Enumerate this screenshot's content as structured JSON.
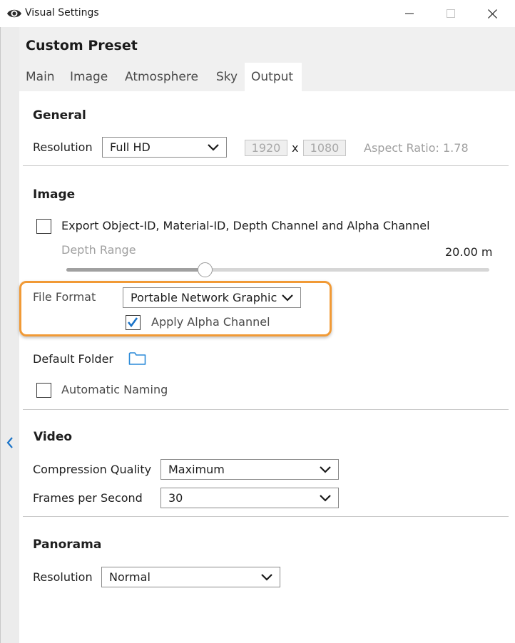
{
  "window": {
    "title": "Visual Settings",
    "icons": {
      "app": "eye-icon",
      "minimize": "minimize-icon",
      "maximize": "maximize-icon",
      "close": "close-icon"
    }
  },
  "header": {
    "title": "Custom Preset"
  },
  "tabs": [
    {
      "label": "Main"
    },
    {
      "label": "Image"
    },
    {
      "label": "Atmosphere"
    },
    {
      "label": "Sky"
    },
    {
      "label": "Output",
      "active": true
    }
  ],
  "general": {
    "title": "General",
    "resolution_label": "Resolution",
    "resolution_value": "Full HD",
    "width": "1920",
    "times": "x",
    "height": "1080",
    "aspect_ratio": "Aspect Ratio: 1.78"
  },
  "image": {
    "title": "Image",
    "export_label": "Export Object-ID, Material-ID, Depth Channel and Alpha Channel",
    "export_checked": false,
    "depth_label": "Depth Range",
    "depth_value": "20.00 m",
    "depth_slider_fraction": 0.33,
    "file_format_label": "File Format",
    "file_format_value": "Portable Network Graphics",
    "alpha_label": "Apply Alpha Channel",
    "alpha_checked": true,
    "default_folder_label": "Default Folder",
    "auto_naming_label": "Automatic Naming",
    "auto_naming_checked": false
  },
  "video": {
    "title": "Video",
    "compression_label": "Compression Quality",
    "compression_value": "Maximum",
    "fps_label": "Frames per Second",
    "fps_value": "30"
  },
  "panorama": {
    "title": "Panorama",
    "resolution_label": "Resolution",
    "resolution_value": "Normal"
  },
  "colors": {
    "accent_highlight": "#f19a36",
    "checkbox_check": "#1a73c8",
    "folder_icon": "#2a8ad8"
  }
}
